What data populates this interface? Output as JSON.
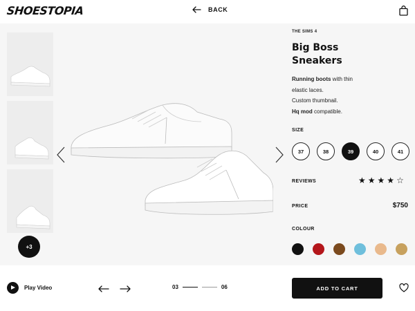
{
  "header": {
    "logo": "SHOESTOPIA",
    "back_label": "BACK"
  },
  "gallery": {
    "more_label": "+3",
    "thumbnails": [
      "thumbnail-pair",
      "thumbnail-side",
      "thumbnail-angle"
    ]
  },
  "product": {
    "brand": "THE SIMS 4",
    "title_line1": "Big Boss",
    "title_line2": "Sneakers",
    "desc_line1_bold": "Running boots",
    "desc_line1_rest": " with thin",
    "desc_line2": "elastic laces.",
    "desc_line3": "Custom thumbnail.",
    "desc_line4_bold": "Hq mod",
    "desc_line4_rest": " compatible."
  },
  "size": {
    "label": "SIZE",
    "options": [
      "37",
      "38",
      "39",
      "40",
      "41"
    ],
    "selected": "39"
  },
  "reviews": {
    "label": "REVIEWS",
    "rating": 4,
    "max": 5
  },
  "price": {
    "label": "PRICE",
    "value": "$750"
  },
  "colour": {
    "label": "COLOUR",
    "swatches": [
      "#111111",
      "#b4161b",
      "#7b4a1e",
      "#6fbfdc",
      "#e9b98c",
      "#c7a15e"
    ]
  },
  "footer": {
    "play_label": "Play Video",
    "page_current": "03",
    "page_total": "06",
    "cart_label": "ADD TO CART"
  },
  "icons": [
    "back-arrow-icon",
    "shopping-bag-icon",
    "chevron-left-icon",
    "chevron-right-icon",
    "play-icon",
    "arrow-left-icon",
    "arrow-right-icon",
    "heart-icon",
    "star-icon"
  ]
}
